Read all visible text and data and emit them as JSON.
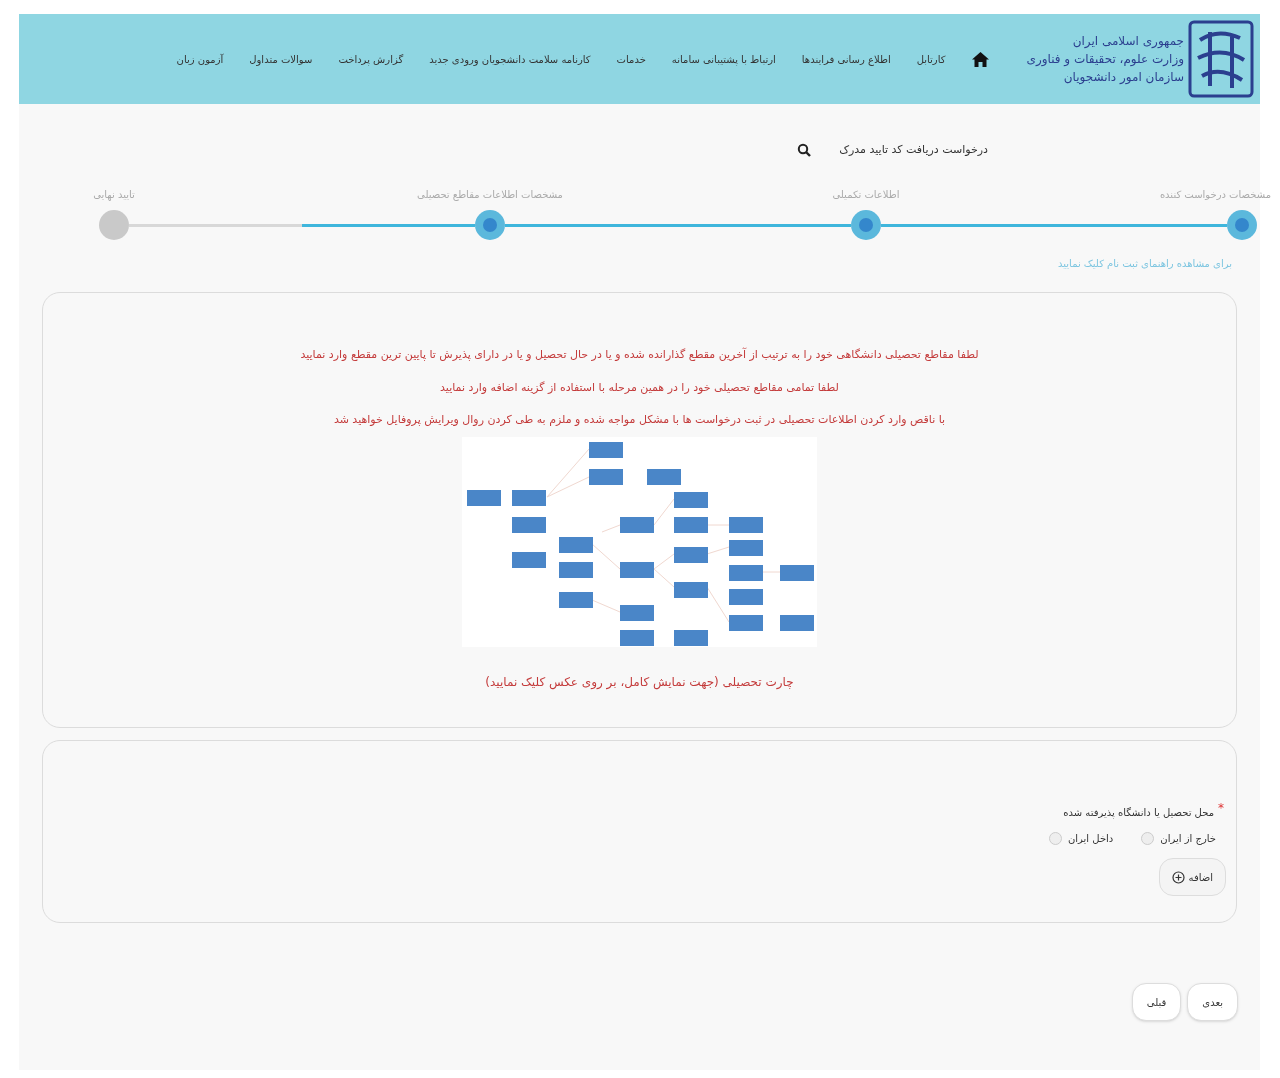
{
  "header": {
    "logo_lines": [
      "جمهوری اسلامی ایران",
      "وزارت علوم، تحقیقات و فناوری",
      "سازمان امور دانشجویان"
    ],
    "nav": [
      "کارتابل",
      "اطلاع رسانی فرایندها",
      "ارتباط با پشتیبانی سامانه",
      "خدمات",
      "کارنامه سلامت دانشجویان ورودی جدید",
      "گزارش پرداخت",
      "سوالات متداول",
      "آزمون زبان"
    ]
  },
  "page_title": "درخواست دریافت کد تایید مدرک",
  "steps": [
    {
      "label": "مشخصات درخواست کننده",
      "done": true
    },
    {
      "label": "اطلاعات تکمیلی",
      "done": true
    },
    {
      "label": "مشخصات اطلاعات مقاطع تحصیلی",
      "done": true
    },
    {
      "label": "تایید نهایی",
      "done": false
    }
  ],
  "help_link": "برای مشاهده راهنمای ثبت نام کلیک نمایید",
  "notices": [
    "لطفا مقاطع تحصیلی دانشگاهی خود را به ترتیب از آخرین مقطع گذارانده شده و یا در حال تحصیل و یا در دارای پذیرش تا پایین ترین مقطع وارد نمایید",
    "لطفا تمامی مقاطع تحصیلی خود را در همین مرحله با استفاده از گزینه اضافه وارد نمایید",
    "با ناقص وارد کردن اطلاعات تحصیلی در ثبت درخواست ها با مشکل مواجه شده و ملزم به طی کردن روال ویرایش پروفایل خواهید شد"
  ],
  "chart_caption": "چارت تحصیلی (جهت نمایش کامل، بر روی عکس کلیک نمایید)",
  "study_place": {
    "required_mark": "*",
    "label": "محل تحصیل یا دانشگاه پذیرفته شده",
    "options": [
      {
        "label": "خارج از ایران",
        "selected": false
      },
      {
        "label": "داخل ایران",
        "selected": false
      }
    ]
  },
  "add_button": "اضافه",
  "buttons": [
    "بعدی",
    "قبلی"
  ]
}
